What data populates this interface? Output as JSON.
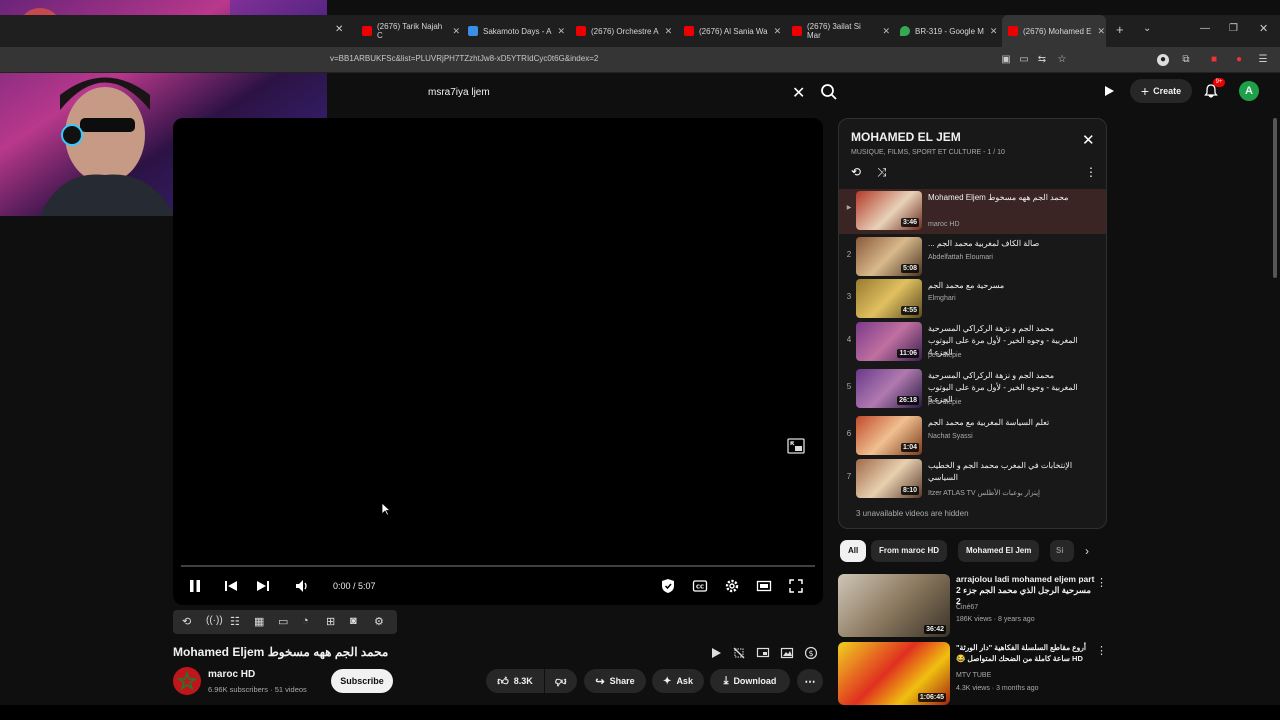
{
  "browser": {
    "tabs": [
      {
        "label": "(2676) Tarik Najah C",
        "color": "#e00"
      },
      {
        "label": "Sakamoto Days - A",
        "color": "#3a8ee6"
      },
      {
        "label": "(2676) Orchestre A",
        "color": "#e00"
      },
      {
        "label": "(2676) Al Sania Wa",
        "color": "#e00"
      },
      {
        "label": "(2676) 3ailat Si Mar",
        "color": "#e00"
      },
      {
        "label": "BR-319 - Google M",
        "color": "#34a853"
      },
      {
        "label": "(2676) Mohamed E",
        "color": "#e00"
      }
    ],
    "url": "v=BB1ARBUKFSc&list=PLUVRjPH7TZzhtJw8-xD5YTRIdCyc0t6G&index=2"
  },
  "header": {
    "search_value": "msra7iya ljem",
    "create_label": "Create",
    "notification_count": "9+",
    "avatar_letter": "A"
  },
  "player": {
    "time": "0:00 / 5:07",
    "progress": 0.0
  },
  "video": {
    "title": "Mohamed Eljem محمد الجم ههه مسخوط",
    "channel": "maroc HD",
    "subs": "6.96K subscribers · 51 videos",
    "subscribe_label": "Subscribe",
    "likes": "8.3K",
    "share_label": "Share",
    "ask_label": "Ask",
    "download_label": "Download"
  },
  "playlist": {
    "title": "MOHAMED EL JEM",
    "subtitle": "MUSIQUE, FILMS, SPORT ET CULTURE - 1 / 10",
    "hidden_note": "3 unavailable videos are hidden",
    "items": [
      {
        "index": "▶",
        "title": "Mohamed Eljem محمد الجم ههه مسخوط",
        "channel": "maroc HD",
        "duration": "3:46"
      },
      {
        "index": "2",
        "title": "صالة الكاف لمغربية محمد الجم ...",
        "channel": "Abdelfattah Eloumari",
        "duration": "5:08"
      },
      {
        "index": "3",
        "title": "مسرحية مع محمد الجم",
        "channel": "Elmghari",
        "duration": "4:55"
      },
      {
        "index": "4",
        "title": "محمد الجم و نزهة الركراكي المسرحية المغربية - وجوه الخير - لأول مرة على اليوتوب الجزء 4",
        "channel": "pew diepie",
        "duration": "11:06"
      },
      {
        "index": "5",
        "title": "محمد الجم و نزهة الركراكي المسرحية المغربية - وجوه الخير - لأول مرة على اليوتوب الجزء 5",
        "channel": "pew diepie",
        "duration": "26:18"
      },
      {
        "index": "6",
        "title": "تعلم السياسة المغربية مع محمد الجم",
        "channel": "Nachat Syassi",
        "duration": "1:04"
      },
      {
        "index": "7",
        "title": "الإنتخابات في المغرب محمد الجم و الخطيب السياسي",
        "channel": "Itzer ATLAS TV إيتزار بوعبات الأطلس",
        "duration": "8:10"
      }
    ]
  },
  "chips": [
    "All",
    "From maroc HD",
    "Mohamed El Jem",
    "Si"
  ],
  "recommendations": [
    {
      "title": "arrajolou ladi mohamed eljem part 2 مسرحية الرجل الذي محمد الجم جزء 2",
      "channel": "Ciné67",
      "meta": "186K views · 8 years ago",
      "duration": "36:42"
    },
    {
      "title": "أروع مقاطع السلسلة الفكاهية \"دار الورثة\" HD ساعة كاملة من الضحك المتواصل 😂",
      "channel": "MTV TUBE",
      "meta": "4.3K views · 3 months ago",
      "duration": "1:06:45"
    }
  ]
}
